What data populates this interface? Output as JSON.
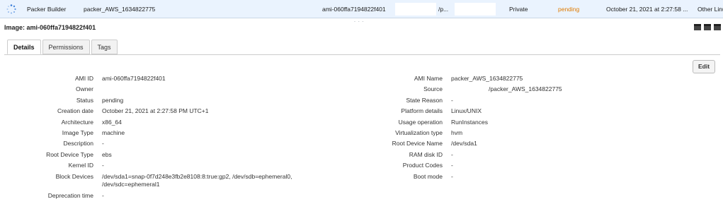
{
  "top_row": {
    "name": "Packer Builder",
    "ami_name": "packer_AWS_1634822775",
    "ami_id": "ami-060ffa7194822f401",
    "source": "/p...",
    "visibility": "Private",
    "status": "pending",
    "creation_date": "October 21, 2021 at 2:27:58 ...",
    "platform": "Other Linu",
    "status_color": "#e07b00",
    "row_bg": "#eaf3fe"
  },
  "header": {
    "title": "Image: ami-060ffa7194822f401",
    "grip": "- - -"
  },
  "tabs": [
    {
      "label": "Details",
      "active": true
    },
    {
      "label": "Permissions",
      "active": false
    },
    {
      "label": "Tags",
      "active": false
    }
  ],
  "edit_label": "Edit",
  "details_left": [
    {
      "label": "AMI ID",
      "value": "ami-060ffa7194822f401"
    },
    {
      "label": "Owner",
      "value": ""
    },
    {
      "label": "Status",
      "value": "pending"
    },
    {
      "label": "Creation date",
      "value": "October 21, 2021 at 2:27:58 PM UTC+1"
    },
    {
      "label": "Architecture",
      "value": "x86_64"
    },
    {
      "label": "Image Type",
      "value": "machine"
    },
    {
      "label": "Description",
      "value": "-"
    },
    {
      "label": "Root Device Type",
      "value": "ebs"
    },
    {
      "label": "Kernel ID",
      "value": "-"
    },
    {
      "label": "Block Devices",
      "value": "/dev/sda1=snap-0f7d248e3fb2e8108:8:true:gp2, /dev/sdb=ephemeral0, /dev/sdc=ephemeral1"
    },
    {
      "label": "Deprecation time",
      "value": "-"
    }
  ],
  "details_right": [
    {
      "label": "AMI Name",
      "value": "packer_AWS_1634822775"
    },
    {
      "label": "Source",
      "value": "/packer_AWS_1634822775"
    },
    {
      "label": "State Reason",
      "value": "-"
    },
    {
      "label": "Platform details",
      "value": "Linux/UNIX"
    },
    {
      "label": "Usage operation",
      "value": "RunInstances"
    },
    {
      "label": "Virtualization type",
      "value": "hvm"
    },
    {
      "label": "Root Device Name",
      "value": "/dev/sda1"
    },
    {
      "label": "RAM disk ID",
      "value": "-"
    },
    {
      "label": "Product Codes",
      "value": "-"
    },
    {
      "label": "Boot mode",
      "value": "-"
    }
  ]
}
